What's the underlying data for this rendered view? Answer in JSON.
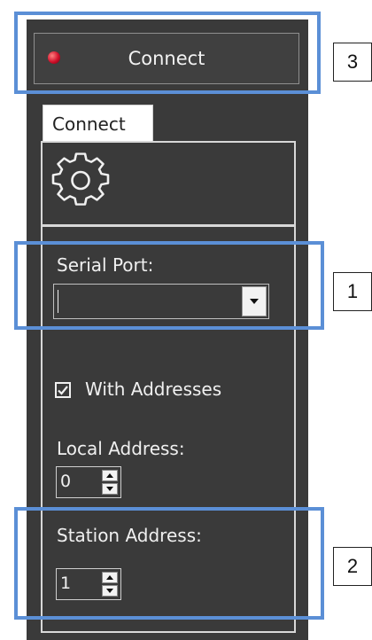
{
  "header": {
    "connect_label": "Connect",
    "status_led_color": "#d0102a"
  },
  "tabs": [
    {
      "label": "Connect",
      "active": true
    }
  ],
  "settings": {
    "gear_icon": "gear-icon",
    "serial_port_label": "Serial Port:",
    "serial_port_value": "",
    "with_addresses_label": "With Addresses",
    "with_addresses_checked": true,
    "local_address_label": "Local Address:",
    "local_address_value": "0",
    "station_address_label": "Station Address:",
    "station_address_value": "1"
  },
  "callouts": [
    {
      "number": "3"
    },
    {
      "number": "1"
    },
    {
      "number": "2"
    }
  ],
  "colors": {
    "panel_bg": "#3a3a3a",
    "callout_border": "#5b8fd6"
  }
}
